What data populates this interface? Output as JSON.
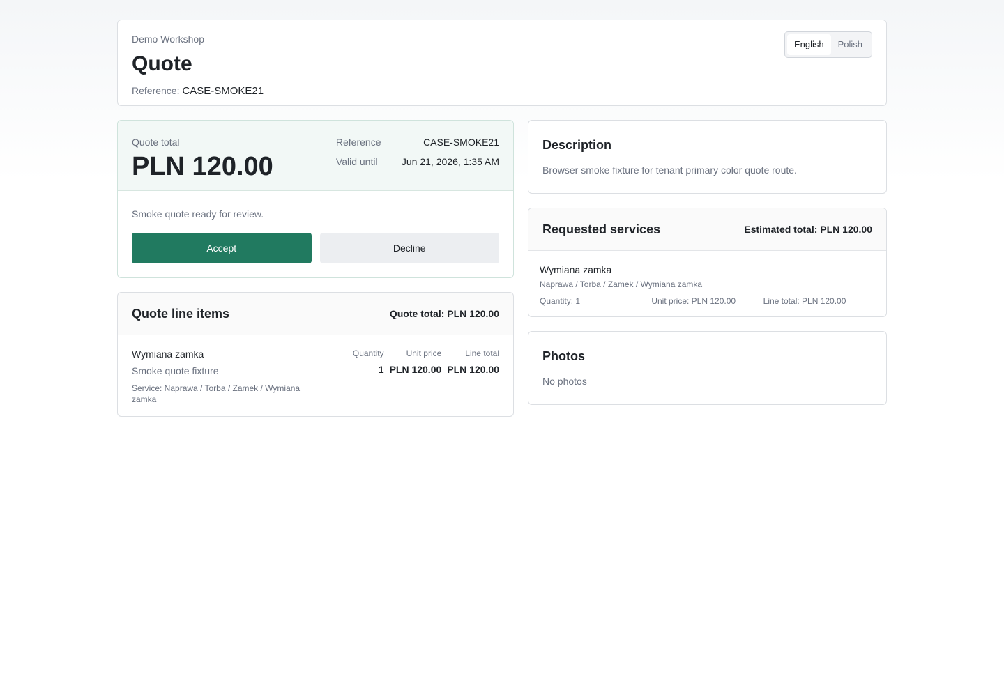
{
  "header": {
    "workshop": "Demo Workshop",
    "title": "Quote",
    "reference_label": "Reference:",
    "reference_value": "CASE-SMOKE21",
    "languages": [
      "English",
      "Polish"
    ],
    "active_language": "English"
  },
  "summary": {
    "total_label": "Quote total",
    "total_amount": "PLN 120.00",
    "reference_label": "Reference",
    "reference_value": "CASE-SMOKE21",
    "valid_label": "Valid until",
    "valid_value": "Jun 21, 2026, 1:35 AM",
    "message": "Smoke quote ready for review.",
    "accept_label": "Accept",
    "decline_label": "Decline",
    "accent_color": "#217a60"
  },
  "line_items": {
    "title": "Quote line items",
    "total_text": "Quote total: PLN 120.00",
    "headers": {
      "quantity": "Quantity",
      "unit_price": "Unit price",
      "line_total": "Line total"
    },
    "items": [
      {
        "name": "Wymiana zamka",
        "description": "Smoke quote fixture",
        "service": "Service: Naprawa / Torba / Zamek / Wymiana zamka",
        "quantity": "1",
        "unit_price": "PLN 120.00",
        "line_total": "PLN 120.00"
      }
    ]
  },
  "description": {
    "title": "Description",
    "text": "Browser smoke fixture for tenant primary color quote route."
  },
  "requested_services": {
    "title": "Requested services",
    "estimated_total": "Estimated total: PLN 120.00",
    "items": [
      {
        "name": "Wymiana zamka",
        "path": "Naprawa / Torba / Zamek / Wymiana zamka",
        "quantity": "Quantity: 1",
        "unit_price": "Unit price: PLN 120.00",
        "line_total": "Line total: PLN 120.00"
      }
    ]
  },
  "photos": {
    "title": "Photos",
    "empty_text": "No photos"
  }
}
